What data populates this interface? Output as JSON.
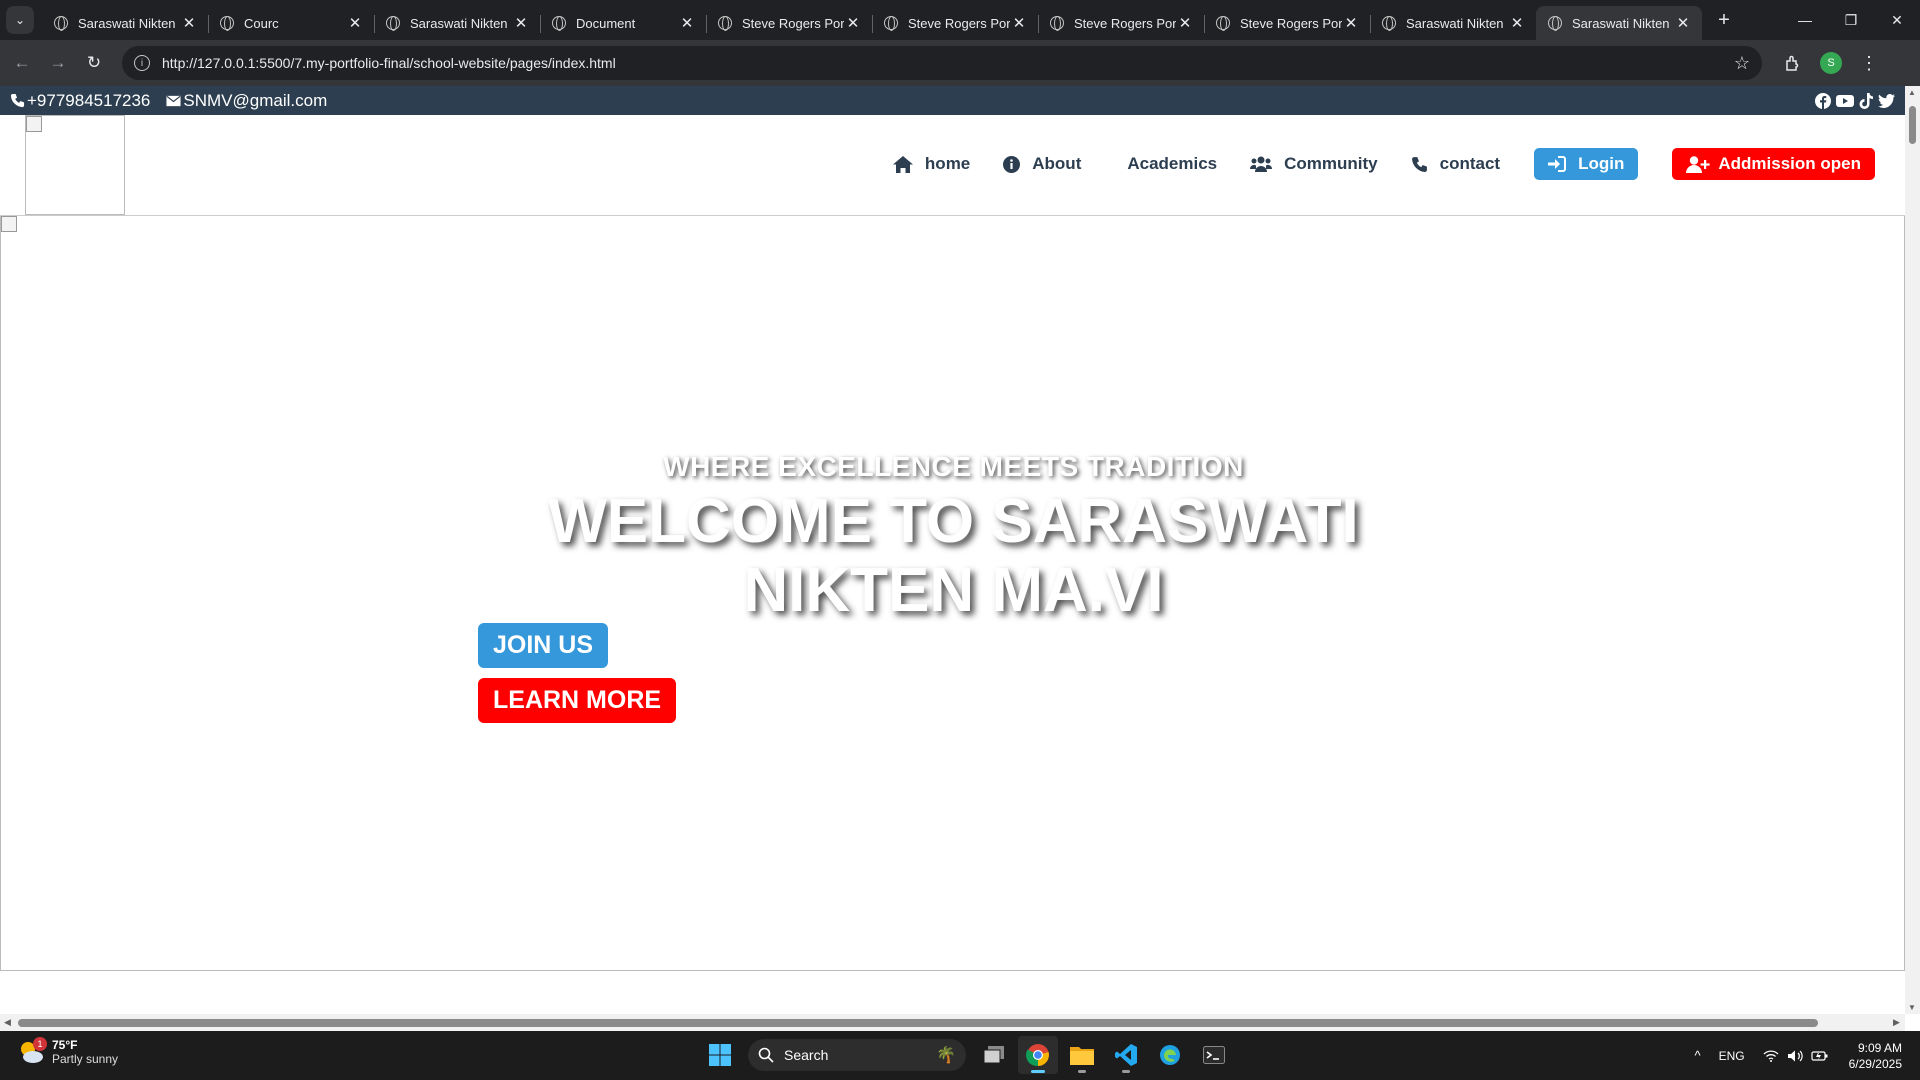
{
  "browser": {
    "tabs": [
      {
        "title": "Saraswati Nikten M",
        "active": false
      },
      {
        "title": "Courc",
        "active": false
      },
      {
        "title": "Saraswati Nikten M",
        "active": false
      },
      {
        "title": "Document",
        "active": false
      },
      {
        "title": "Steve Rogers Portf",
        "active": false
      },
      {
        "title": "Steve Rogers Portf",
        "active": false
      },
      {
        "title": "Steve Rogers Portf",
        "active": false
      },
      {
        "title": "Steve Rogers Portf",
        "active": false
      },
      {
        "title": "Saraswati Nikten M",
        "active": false
      },
      {
        "title": "Saraswati Nikten M",
        "active": true
      }
    ],
    "url": "http://127.0.0.1:5500/7.my-portfolio-final/school-website/pages/index.html",
    "profile_initial": "S"
  },
  "site": {
    "topbar": {
      "phone": "+977984517236",
      "email": "SNMV@gmail.com",
      "social": [
        "facebook-icon",
        "youtube-icon",
        "tiktok-icon",
        "twitter-icon"
      ]
    },
    "nav": {
      "home": "home",
      "about": "About",
      "academics": "Academics",
      "community": "Community",
      "contact": "contact",
      "login": "Login",
      "admission": "Addmission open"
    },
    "hero": {
      "tagline": "WHERE EXCELLENCE MEETS TRADITION",
      "title": "WELCOME TO SARASWATI NIKTEN MA.VI",
      "join": "JOIN US",
      "learn": "LEARN MORE"
    },
    "colors": {
      "topbar": "#2c3e50",
      "primary": "#3498db",
      "danger": "#ff0000"
    }
  },
  "taskbar": {
    "weather_temp": "75°F",
    "weather_desc": "Partly sunny",
    "weather_badge": "1",
    "search_placeholder": "Search",
    "language": "ENG",
    "time": "9:09 AM",
    "date": "6/29/2025"
  }
}
